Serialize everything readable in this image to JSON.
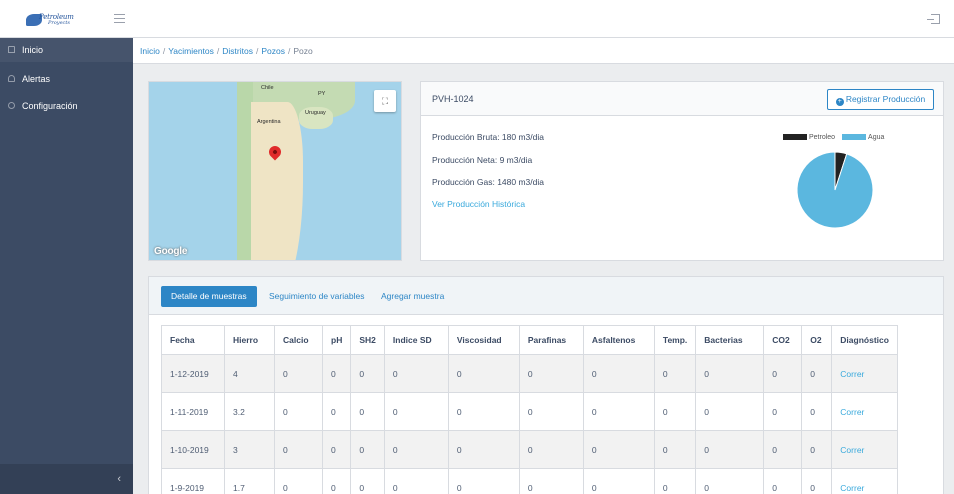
{
  "brand": {
    "name": "Petroleum",
    "sub": "Proyects"
  },
  "sidebar": {
    "items": [
      {
        "label": "Inicio",
        "icon": "home-icon"
      },
      {
        "label": "Alertas",
        "icon": "bell-icon"
      },
      {
        "label": "Configuración",
        "icon": "gear-icon"
      }
    ],
    "collapse_glyph": "‹"
  },
  "breadcrumb": {
    "items": [
      "Inicio",
      "Yacimientos",
      "Distritos",
      "Pozos"
    ],
    "current": "Pozo"
  },
  "map": {
    "labels": {
      "chile": "Chile",
      "argentina": "Argentina",
      "uruguay": "Uruguay",
      "py": "PY"
    },
    "google": "Google"
  },
  "well": {
    "name": "PVH-1024",
    "register_label": "Registrar Producción",
    "gross": "Producción Bruta: 180 m3/dia",
    "net": "Producción Neta: 9 m3/dia",
    "gas": "Producción Gas: 1480 m3/dia",
    "history_link": "Ver Producción Histórica"
  },
  "colors": {
    "accent": "#2d86c6",
    "link": "#39a9dc",
    "sidebar": "#3c4b64",
    "petroleo": "#222222",
    "agua": "#5bb7df"
  },
  "chart_data": {
    "type": "pie",
    "labels": [
      "Petroleo",
      "Agua"
    ],
    "values": [
      9,
      171
    ],
    "legend": "top"
  },
  "tabs": [
    "Detalle de muestras",
    "Seguimiento de variables",
    "Agregar muestra"
  ],
  "table": {
    "headers": [
      "Fecha",
      "Hierro",
      "Calcio",
      "pH",
      "SH2",
      "Indice SD",
      "Viscosidad",
      "Parafinas",
      "Asfaltenos",
      "Temp.",
      "Bacterias",
      "CO2",
      "O2",
      "Diagnóstico"
    ],
    "rows": [
      [
        "1-12-2019",
        "4",
        "0",
        "0",
        "0",
        "0",
        "0",
        "0",
        "0",
        "0",
        "0",
        "0",
        "0",
        "Correr"
      ],
      [
        "1-11-2019",
        "3.2",
        "0",
        "0",
        "0",
        "0",
        "0",
        "0",
        "0",
        "0",
        "0",
        "0",
        "0",
        "Correr"
      ],
      [
        "1-10-2019",
        "3",
        "0",
        "0",
        "0",
        "0",
        "0",
        "0",
        "0",
        "0",
        "0",
        "0",
        "0",
        "Correr"
      ],
      [
        "1-9-2019",
        "1.7",
        "0",
        "0",
        "0",
        "0",
        "0",
        "0",
        "0",
        "0",
        "0",
        "0",
        "0",
        "Correr"
      ]
    ]
  }
}
